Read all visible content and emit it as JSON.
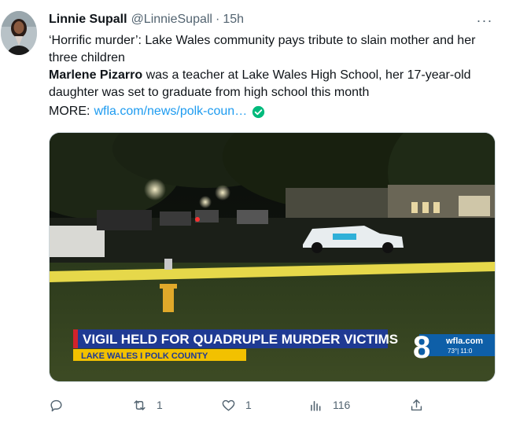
{
  "tweet": {
    "author_name": "Linnie Supall",
    "author_handle": "@LinnieSupall",
    "separator": "·",
    "timestamp": "15h",
    "more_label": "···",
    "text_line1": "‘Horrific murder’: Lake Wales community pays tribute to slain mother and her three children",
    "text_bold_name": "Marlene Pizarro",
    "text_line2_rest": " was a teacher at Lake Wales High School, her 17-year-old daughter was set to graduate from high school this month",
    "more_prefix": "MORE:",
    "link_text": "wfla.com/news/polk-coun…"
  },
  "media": {
    "headline": "VIGIL HELD FOR QUADRUPLE MURDER VICTIMS",
    "location": "LAKE WALES I POLK COUNTY",
    "channel_number": "8",
    "channel_brand": "wfla.com",
    "weather": "73°| 11:0"
  },
  "actions": {
    "reply_count": "",
    "retweet_count": "1",
    "like_count": "1",
    "views_count": "116"
  },
  "colors": {
    "accent": "#1d9bf0",
    "verified": "#00ba7c",
    "muted": "#536471",
    "lower_third_blue": "#1f3a93",
    "lower_third_yellow": "#f2c100"
  }
}
